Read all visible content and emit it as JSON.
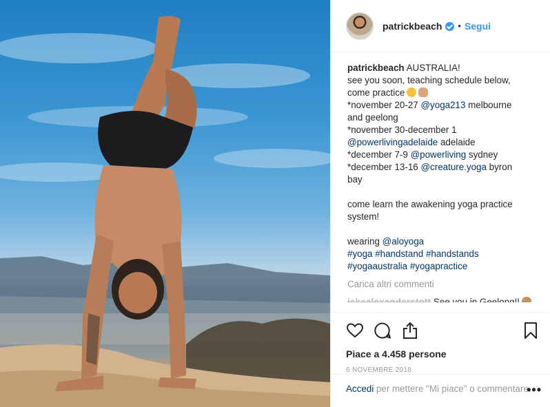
{
  "post": {
    "username": "patrickbeach",
    "follow_label": "Segui",
    "separator": "•"
  },
  "caption": {
    "user": "patrickbeach",
    "first_text": " AUSTRALIA!",
    "line2": "see you soon, teaching schedule below,",
    "line3": "come practice",
    "line4_pre": "*november 20-27 ",
    "line4_tag": "@yoga213",
    "line4_post": " melbourne",
    "line5": "and geelong",
    "line6": "*november 30-december 1",
    "line7_tag": "@powerlivingadelaide",
    "line7_post": " adelaide",
    "line8_pre": "*december 7-9 ",
    "line8_tag": "@powerliving",
    "line8_post": " sydney",
    "line9_pre": "*december 13-16 ",
    "line9_tag": "@creature.yoga",
    "line9_post": " byron",
    "line10": "bay",
    "line11": "come learn the awakening yoga practice",
    "line12": "system!",
    "line13_pre": "wearing ",
    "line13_tag": "@aloyoga",
    "hashtags1": [
      "#yoga",
      "#handstand",
      "#handstands"
    ],
    "hashtags2": [
      "#yogaaustralia",
      "#yogapractice"
    ]
  },
  "load_more": "Carica altri commenti",
  "comment": {
    "user": "jakealexanderstott",
    "text": "See you in Geelong!!"
  },
  "likes_text": "Piace a 4.458 persone",
  "date_text": "6 NOVEMBRE 2018",
  "login": {
    "link": "Accedi",
    "text": " per mettere \"Mi piace\" o commentare."
  },
  "icons": [
    "heart-icon",
    "comment-icon",
    "share-icon",
    "bookmark-icon",
    "more-icon",
    "verified-icon"
  ],
  "colors": {
    "link": "#003569",
    "accent": "#3897f0",
    "muted": "#999999"
  }
}
